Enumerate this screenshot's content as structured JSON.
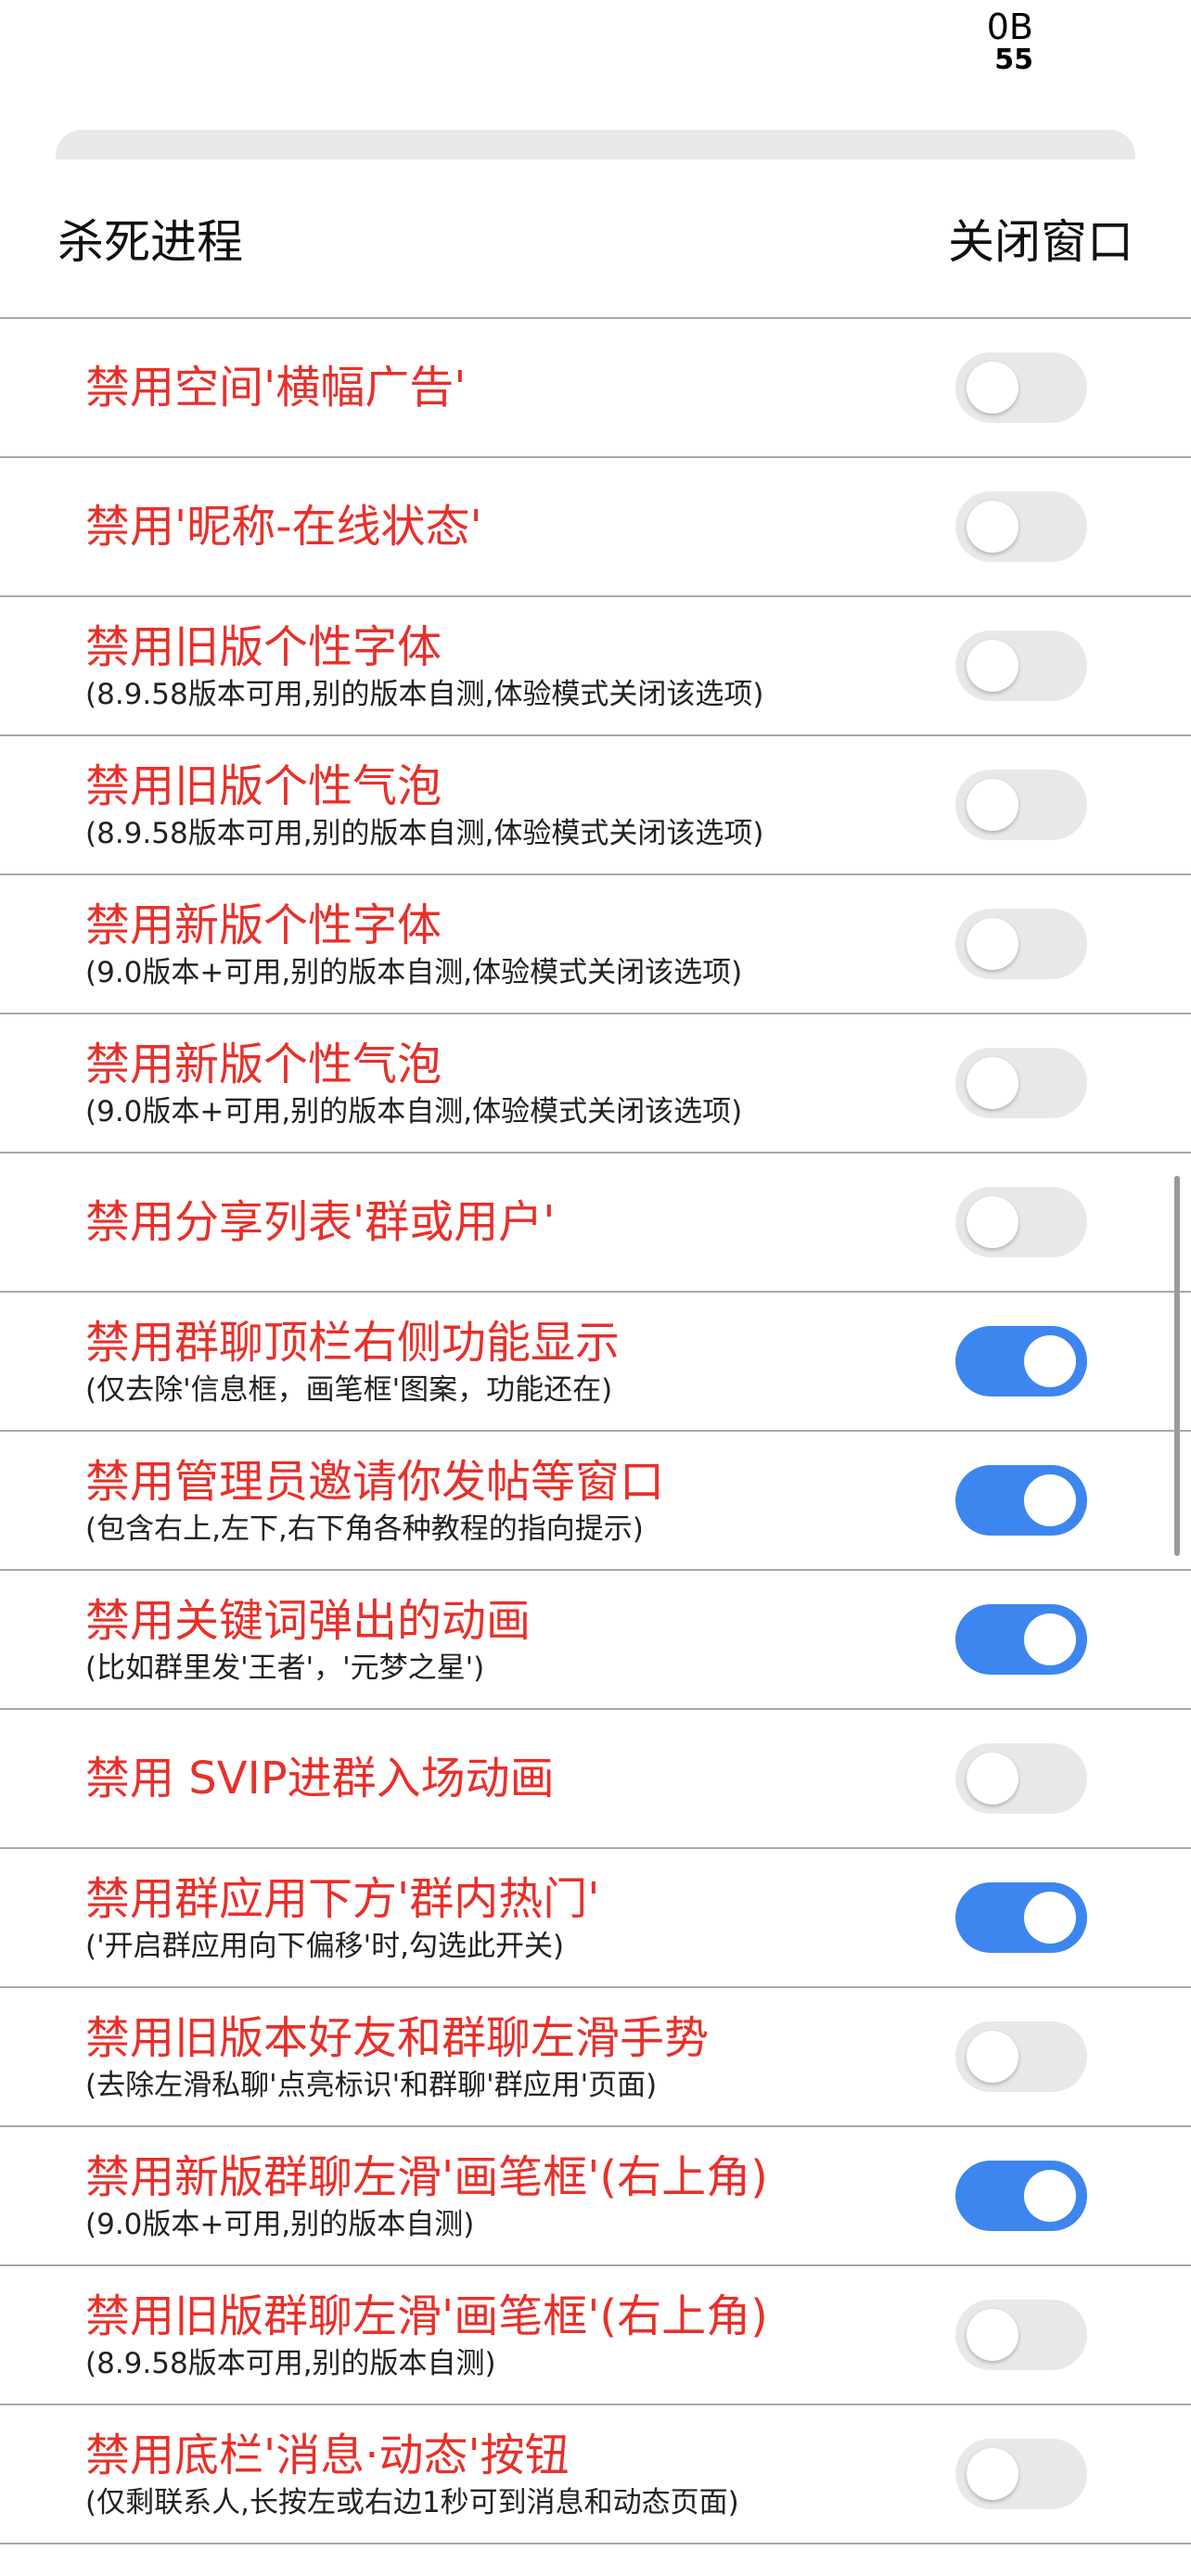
{
  "status": {
    "speed": "0B",
    "speed_unit": "55"
  },
  "header": {
    "left_button": "杀死进程",
    "right_button": "关闭窗口"
  },
  "colors": {
    "title": "#e8302a",
    "toggle_on": "#3d86f0",
    "toggle_off": "#e8e8e8"
  },
  "items": [
    {
      "title": "禁用空间'横幅广告'",
      "subtitle": "",
      "enabled": false
    },
    {
      "title": "禁用'昵称-在线状态'",
      "subtitle": "",
      "enabled": false
    },
    {
      "title": "禁用旧版个性字体",
      "subtitle": "(8.9.58版本可用,别的版本自测,体验模式关闭该选项)",
      "enabled": false
    },
    {
      "title": "禁用旧版个性气泡",
      "subtitle": "(8.9.58版本可用,别的版本自测,体验模式关闭该选项)",
      "enabled": false
    },
    {
      "title": "禁用新版个性字体",
      "subtitle": "(9.0版本+可用,别的版本自测,体验模式关闭该选项)",
      "enabled": false
    },
    {
      "title": "禁用新版个性气泡",
      "subtitle": "(9.0版本+可用,别的版本自测,体验模式关闭该选项)",
      "enabled": false
    },
    {
      "title": "禁用分享列表'群或用户'",
      "subtitle": "",
      "enabled": false
    },
    {
      "title": "禁用群聊顶栏右侧功能显示",
      "subtitle": "(仅去除'信息框，画笔框'图案，功能还在)",
      "enabled": true
    },
    {
      "title": "禁用管理员邀请你发帖等窗口",
      "subtitle": "(包含右上,左下,右下角各种教程的指向提示)",
      "enabled": true
    },
    {
      "title": "禁用关键词弹出的动画",
      "subtitle": "(比如群里发'王者'，'元梦之星')",
      "enabled": true
    },
    {
      "title": "禁用 SVIP进群入场动画",
      "subtitle": "",
      "enabled": false
    },
    {
      "title": "禁用群应用下方'群内热门'",
      "subtitle": "('开启群应用向下偏移'时,勾选此开关)",
      "enabled": true
    },
    {
      "title": "禁用旧版本好友和群聊左滑手势",
      "subtitle": "(去除左滑私聊'点亮标识'和群聊'群应用'页面)",
      "enabled": false
    },
    {
      "title": "禁用新版群聊左滑'画笔框'(右上角)",
      "subtitle": "(9.0版本+可用,别的版本自测)",
      "enabled": true
    },
    {
      "title": "禁用旧版群聊左滑'画笔框'(右上角)",
      "subtitle": "(8.9.58版本可用,别的版本自测)",
      "enabled": false
    },
    {
      "title": "禁用底栏'消息·动态'按钮",
      "subtitle": "(仅剩联系人,长按左或右边1秒可到消息和动态页面)",
      "enabled": false
    }
  ]
}
